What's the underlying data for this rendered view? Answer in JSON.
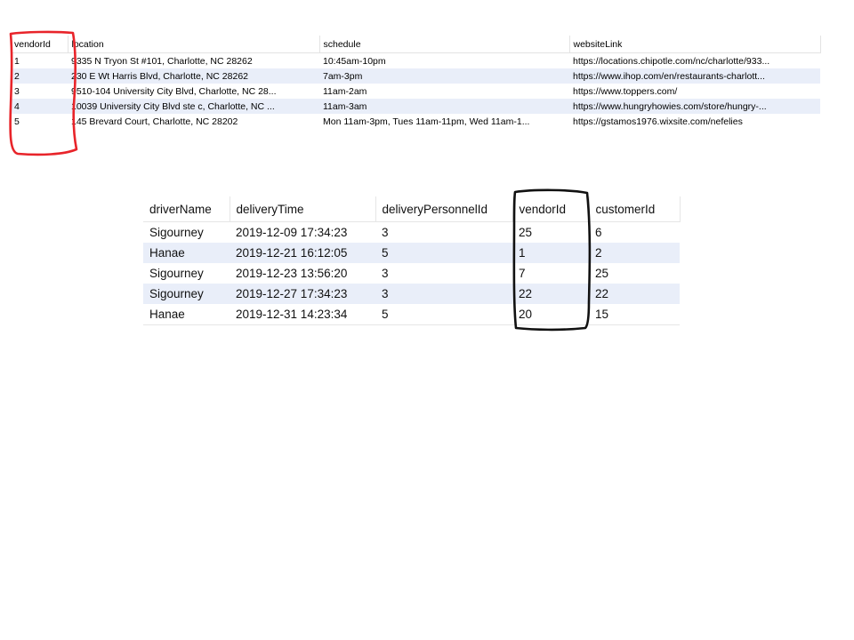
{
  "vendor_table": {
    "columns": [
      "vendorId",
      "location",
      "schedule",
      "websiteLink"
    ],
    "rows": [
      [
        "1",
        "9335 N Tryon St #101, Charlotte, NC 28262",
        "10:45am-10pm",
        "https://locations.chipotle.com/nc/charlotte/933..."
      ],
      [
        "2",
        "230 E Wt Harris Blvd, Charlotte, NC 28262",
        "7am-3pm",
        "https://www.ihop.com/en/restaurants-charlott..."
      ],
      [
        "3",
        "9510-104 University City Blvd, Charlotte, NC 28...",
        "11am-2am",
        "https://www.toppers.com/"
      ],
      [
        "4",
        "10039 University City Blvd ste c, Charlotte, NC ...",
        "11am-3am",
        "https://www.hungryhowies.com/store/hungry-..."
      ],
      [
        "5",
        "145 Brevard Court, Charlotte, NC 28202",
        "Mon 11am-3pm, Tues 11am-11pm, Wed 11am-1...",
        "https://gstamos1976.wixsite.com/nefelies"
      ]
    ]
  },
  "delivery_table": {
    "columns": [
      "driverName",
      "deliveryTime",
      "deliveryPersonnelId",
      "vendorId",
      "customerId"
    ],
    "rows": [
      [
        "Sigourney",
        "2019-12-09 17:34:23",
        "3",
        "25",
        "6"
      ],
      [
        "Hanae",
        "2019-12-21 16:12:05",
        "5",
        "1",
        "2"
      ],
      [
        "Sigourney",
        "2019-12-23 13:56:20",
        "3",
        "7",
        "25"
      ],
      [
        "Sigourney",
        "2019-12-27 17:34:23",
        "3",
        "22",
        "22"
      ],
      [
        "Hanae",
        "2019-12-31 14:23:34",
        "5",
        "20",
        "15"
      ]
    ]
  },
  "annotations": {
    "vendor_id_column_highlight": {
      "color": "#e8242a",
      "target": "vendor_table.vendorId"
    },
    "delivery_vendor_id_highlight": {
      "color": "#111111",
      "target": "delivery_table.vendorId"
    }
  }
}
